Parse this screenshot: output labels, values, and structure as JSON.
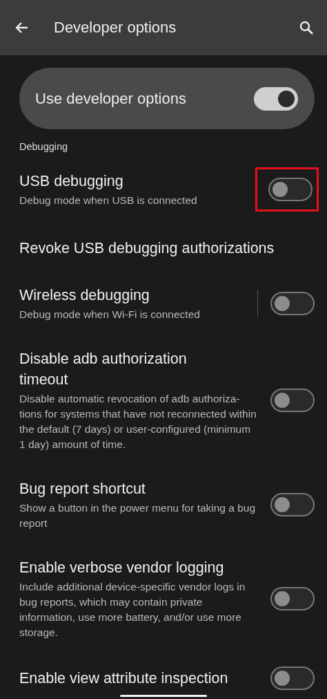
{
  "app_bar": {
    "title": "Developer options"
  },
  "main_switch": {
    "label": "Use developer options",
    "on": true
  },
  "section": {
    "title": "Debugging"
  },
  "items": [
    {
      "kind": "switch",
      "title": "USB debugging",
      "summary": "Debug mode when USB is connected",
      "on": false,
      "highlighted": true,
      "divider": false
    },
    {
      "kind": "action",
      "title": "Revoke USB debugging authorizations"
    },
    {
      "kind": "switch",
      "title": "Wireless debugging",
      "summary": "Debug mode when Wi-Fi is connected",
      "on": false,
      "highlighted": false,
      "divider": true
    },
    {
      "kind": "switch",
      "title": "Disable adb authorization timeout",
      "summary": "Disable automatic revocation of adb authoriza-tions for systems that have not reconnected within the default (7 days) or user-configured (minimum 1 day) amount of time.",
      "on": false,
      "highlighted": false,
      "divider": false
    },
    {
      "kind": "switch",
      "title": "Bug report shortcut",
      "summary": "Show a button in the power menu for taking a bug report",
      "on": false,
      "highlighted": false,
      "divider": false
    },
    {
      "kind": "switch",
      "title": "Enable verbose vendor logging",
      "summary": "Include additional device-specific vendor logs in bug reports, which may contain private information, use more battery, and/or use more storage.",
      "on": false,
      "highlighted": false,
      "divider": false
    },
    {
      "kind": "switch",
      "title": "Enable view attribute inspection",
      "on": false,
      "highlighted": false,
      "divider": false
    }
  ]
}
